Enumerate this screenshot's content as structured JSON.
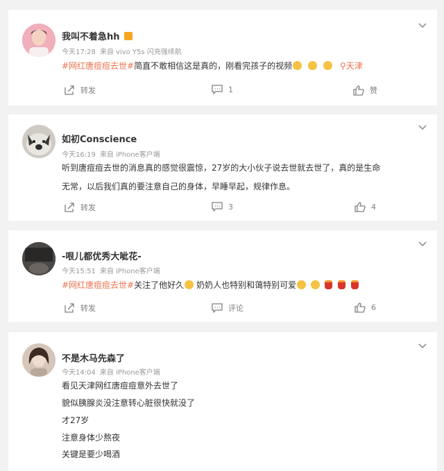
{
  "comments": [
    {
      "username": "我叫不着急hh",
      "time": "今天17:28",
      "source": "来自 vivo Y5s 闪充强续航",
      "hashtag": "#网红唐痘痘去世#",
      "text": "简直不敢相信这是真的，刚看完孩子的视频",
      "location": "天津",
      "actions": {
        "forward": "转发",
        "comments": "1",
        "likes": "赞"
      }
    },
    {
      "username": "如初Conscience",
      "time": "今天16:19",
      "source": "来自 iPhone客户端",
      "lines": [
        "听到唐痘痘去世的消息真的感觉很震惊，27岁的大小伙子说去世就去世了，真的是生命",
        "无常，以后我们真的要注意自己的身体，早睡早起，规律作息。"
      ],
      "actions": {
        "forward": "转发",
        "comments": "3",
        "likes": "4"
      }
    },
    {
      "username": "-哏儿都优秀大呲花-",
      "time": "今天15:51",
      "source": "来自 iPhone客户端",
      "hashtag": "#网红唐痘痘去世#",
      "text_a": "关注了他好久",
      "text_b": "奶奶人也特别和蔼特别可爱",
      "actions": {
        "forward": "转发",
        "comments": "评论",
        "likes": "6"
      }
    },
    {
      "username": "不是木马先森了",
      "time": "今天14:04",
      "source": "来自 iPhone客户端",
      "lines": [
        "看见天津网红唐痘痘意外去世了",
        "貌似胰腺炎没注意转心脏很快就没了",
        "才27岁",
        "注意身体少熬夜",
        "关键是要少喝酒"
      ]
    }
  ]
}
